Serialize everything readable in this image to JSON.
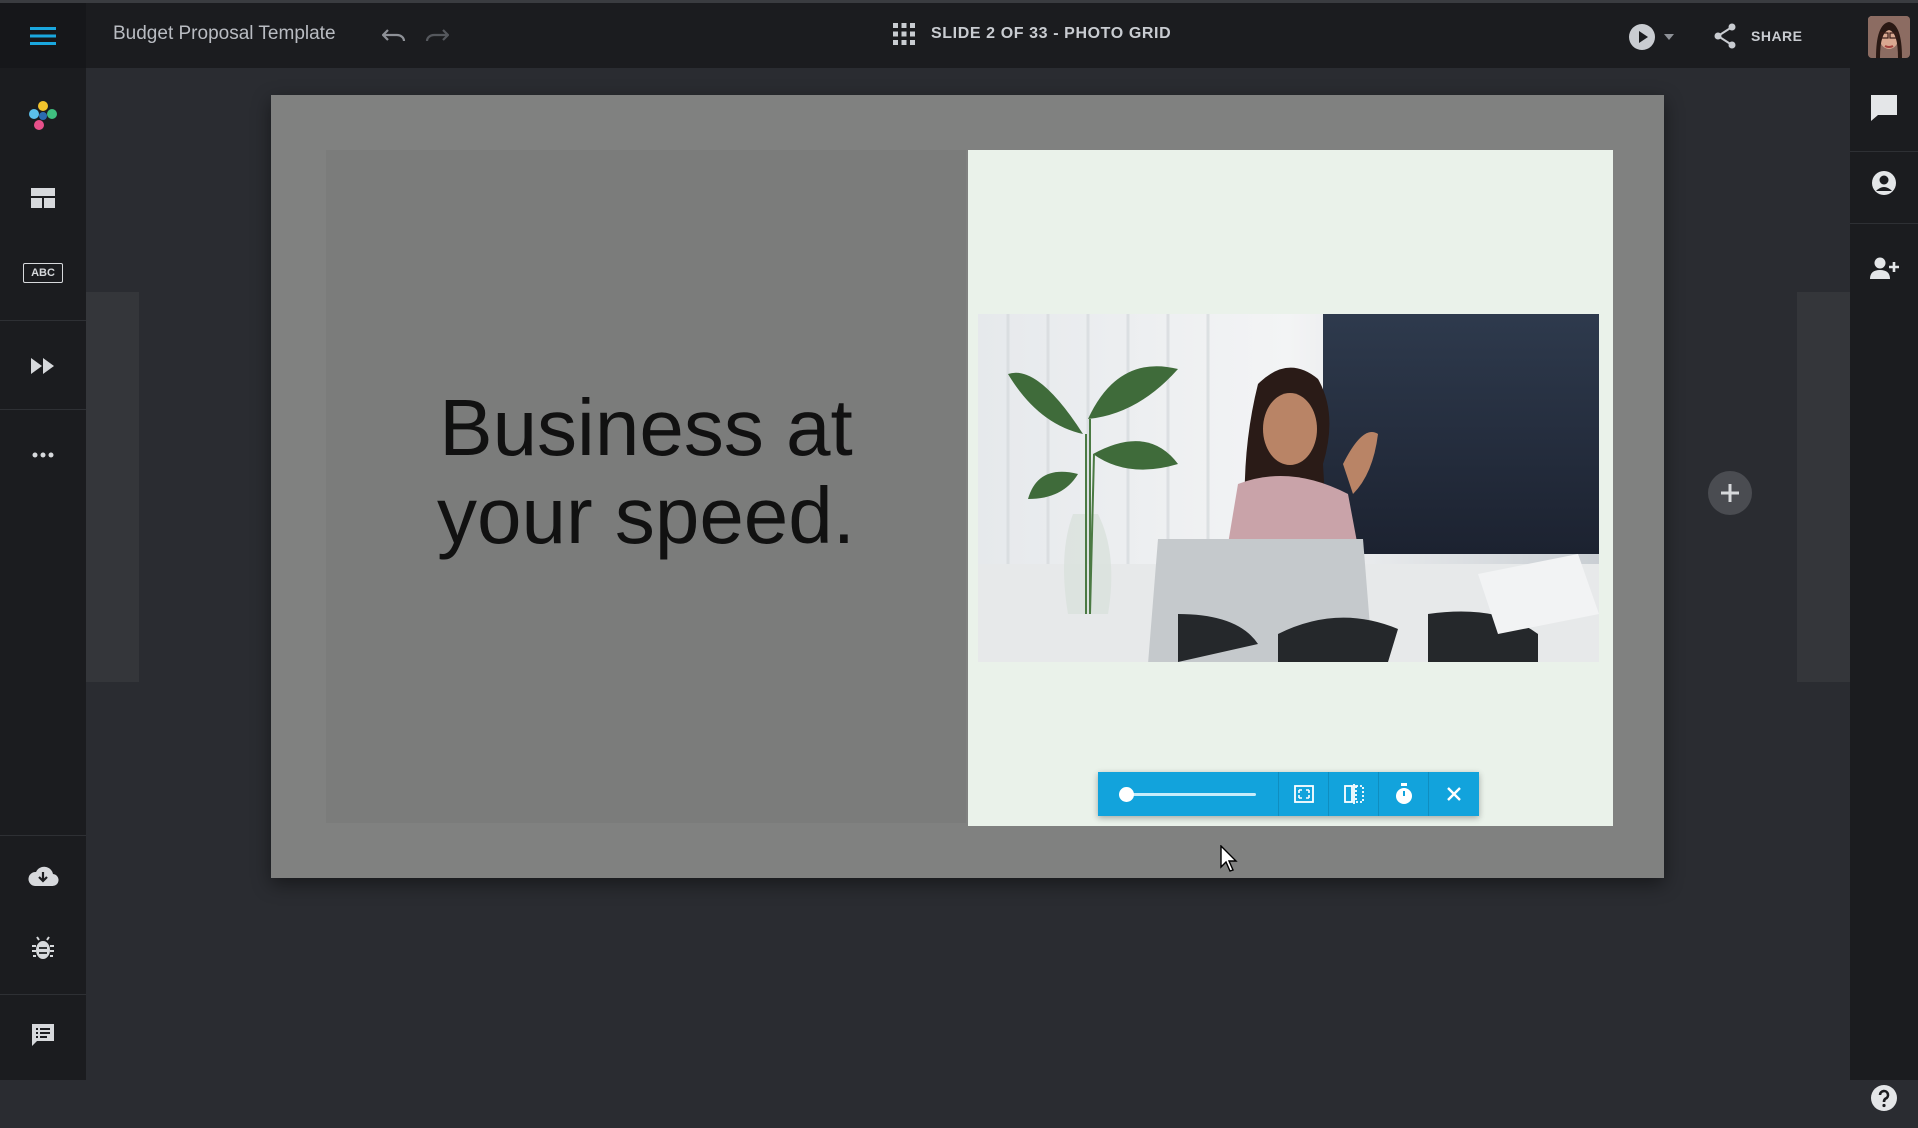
{
  "topbar": {
    "doc_title": "Budget Proposal Template",
    "slide_label": "SLIDE 2 OF 33 - PHOTO GRID",
    "share_label": "SHARE"
  },
  "slide": {
    "headline_line1": "Business at",
    "headline_line2": "your speed."
  },
  "photo_toolbar": {
    "zoom_fraction": 0.05
  },
  "colors": {
    "accent": "#12a3dc",
    "topbar": "#1b1c1f",
    "canvas": "#2a2c31",
    "photo_panel_bg": "#eaf2ea"
  },
  "icons": {
    "menu": "hamburger-icon",
    "undo": "undo-icon",
    "redo": "redo-icon",
    "slide_grid": "grid-icon",
    "play": "play-icon",
    "share": "share-icon",
    "left_rail": [
      "palette-icon",
      "layout-icon",
      "text-icon",
      "transition-icon",
      "more-icon",
      "cloud-download-icon",
      "bug-icon",
      "notes-icon"
    ],
    "right_rail": [
      "comment-icon",
      "account-icon",
      "add-user-icon",
      "help-icon"
    ],
    "toolbar": [
      "fit-icon",
      "flip-icon",
      "timer-icon",
      "close-icon"
    ]
  }
}
